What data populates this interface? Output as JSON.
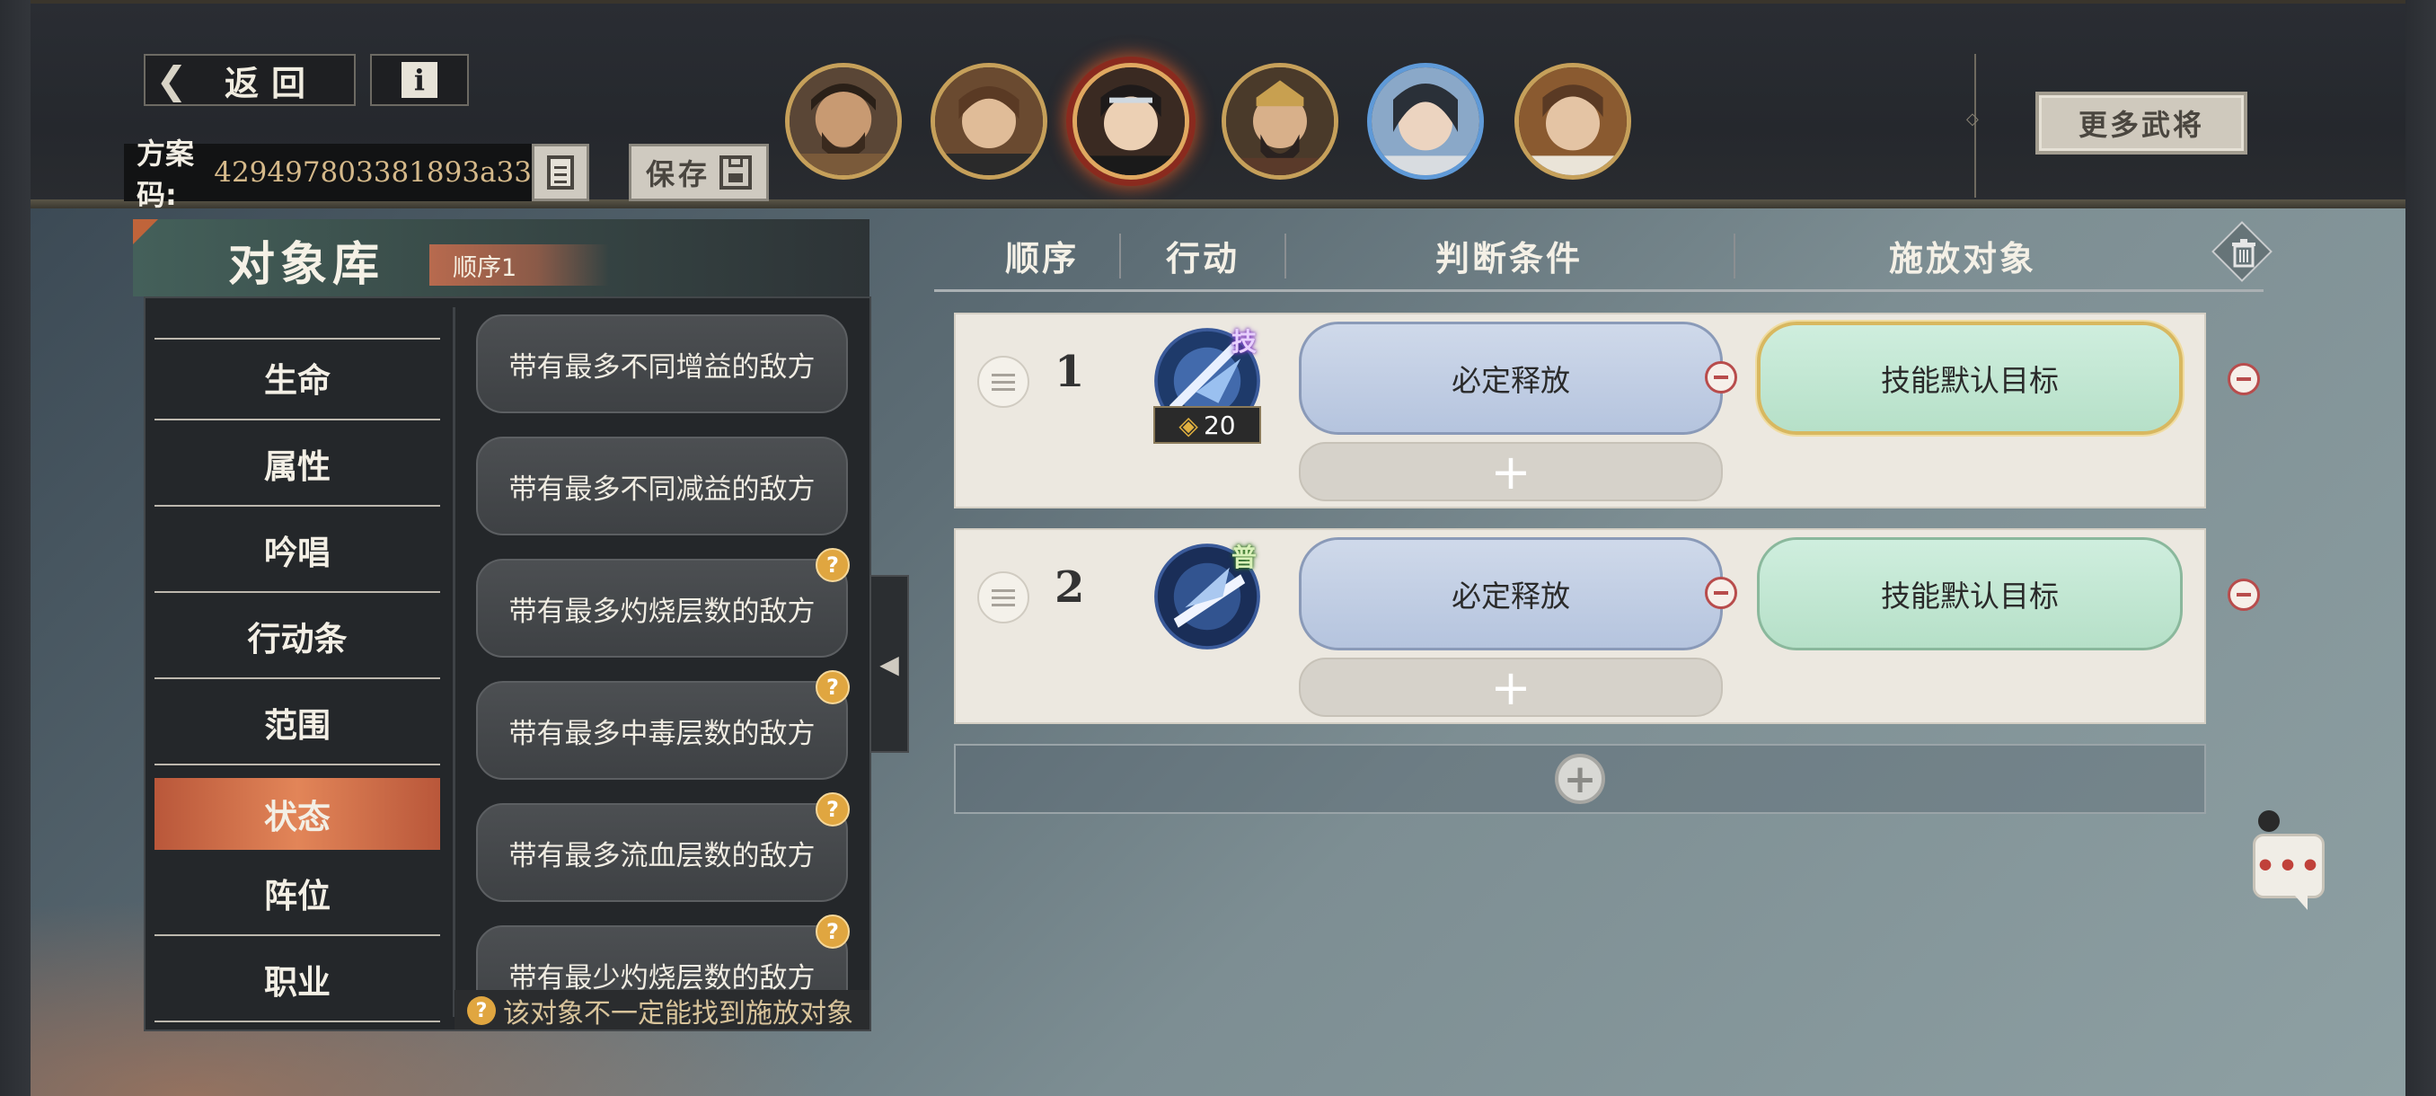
{
  "toolbar": {
    "back_label": "返回",
    "info_label": "i",
    "code_label": "方案码:",
    "code_value": "429497803381893a33",
    "save_label": "保存",
    "more_label": "更多武将"
  },
  "heroes": [
    "hero-1",
    "hero-2",
    "hero-3-selected",
    "hero-4",
    "hero-5",
    "hero-6"
  ],
  "library": {
    "title": "对象库",
    "order_tag": "顺序1",
    "categories": [
      "生命",
      "属性",
      "吟唱",
      "行动条",
      "范围",
      "状态",
      "阵位",
      "职业"
    ],
    "active_category": "状态",
    "options": [
      "带有最多不同增益的敌方",
      "带有最多不同减益的敌方",
      "带有最多灼烧层数的敌方",
      "带有最多中毒层数的敌方",
      "带有最多流血层数的敌方",
      "带有最少灼烧层数的敌方"
    ],
    "option_badges": [
      "",
      "",
      "?",
      "?",
      "?",
      "?"
    ],
    "hint_icon": "?",
    "hint": "该对象不一定能找到施放对象"
  },
  "table": {
    "headers": [
      "顺序",
      "行动",
      "判断条件",
      "施放对象"
    ],
    "rows": [
      {
        "order": "1",
        "skill_tag": "技",
        "cost": "20",
        "condition": "必定释放",
        "target": "技能默认目标"
      },
      {
        "order": "2",
        "skill_tag": "普",
        "cost": "",
        "condition": "必定释放",
        "target": "技能默认目标"
      }
    ],
    "add_symbol": "+"
  },
  "chat": {
    "label": "•••"
  },
  "colors": {
    "accent_orange": "#e28558",
    "condition_blue": "#b5c4de",
    "target_green": "#b6e0c8",
    "minus_red": "#b84c4c"
  }
}
